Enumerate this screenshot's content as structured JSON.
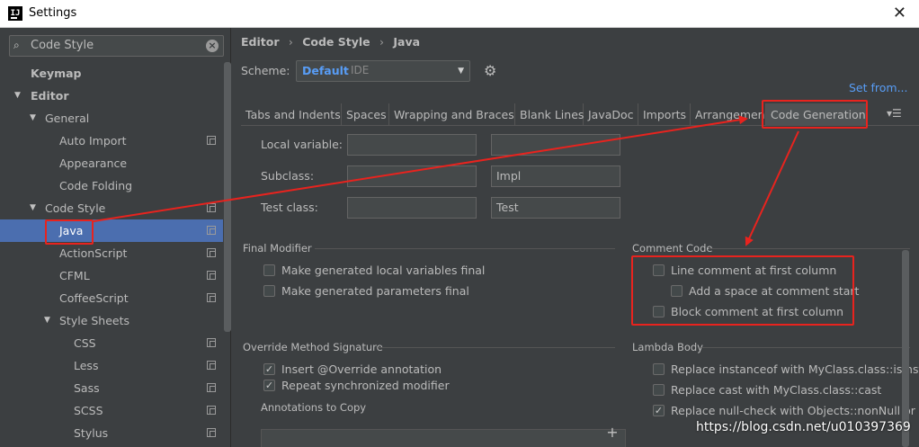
{
  "window": {
    "title": "Settings",
    "app_icon": "IJ"
  },
  "search": {
    "value": "Code Style"
  },
  "sidebar": {
    "items": [
      {
        "label": "Keymap"
      },
      {
        "label": "Editor"
      },
      {
        "label": "General"
      },
      {
        "label": "Auto Import"
      },
      {
        "label": "Appearance"
      },
      {
        "label": "Code Folding"
      },
      {
        "label": "Code Style"
      },
      {
        "label": "Java"
      },
      {
        "label": "ActionScript"
      },
      {
        "label": "CFML"
      },
      {
        "label": "CoffeeScript"
      },
      {
        "label": "Style Sheets"
      },
      {
        "label": "CSS"
      },
      {
        "label": "Less"
      },
      {
        "label": "Sass"
      },
      {
        "label": "SCSS"
      },
      {
        "label": "Stylus"
      }
    ]
  },
  "breadcrumb": {
    "editor": "Editor",
    "code_style": "Code Style",
    "java": "Java",
    "sep": "›"
  },
  "scheme": {
    "label": "Scheme:",
    "value": "Default",
    "scope": "IDE"
  },
  "set_from": "Set from...",
  "tabs": [
    "Tabs and Indents",
    "Spaces",
    "Wrapping and Braces",
    "Blank Lines",
    "JavaDoc",
    "Imports",
    "Arrangement",
    "Code Generation"
  ],
  "naming": {
    "local_variable": {
      "label": "Local variable:",
      "prefix": "",
      "suffix": ""
    },
    "subclass": {
      "label": "Subclass:",
      "prefix": "",
      "suffix": "Impl"
    },
    "test_class": {
      "label": "Test class:",
      "prefix": "",
      "suffix": "Test"
    }
  },
  "final_modifier": {
    "title": "Final Modifier",
    "options": [
      {
        "label": "Make generated local variables final",
        "checked": false
      },
      {
        "label": "Make generated parameters final",
        "checked": false
      }
    ]
  },
  "comment_code": {
    "title": "Comment Code",
    "options": [
      {
        "label": "Line comment at first column",
        "checked": false
      },
      {
        "label": "Add a space at comment start",
        "checked": false
      },
      {
        "label": "Block comment at first column",
        "checked": false
      }
    ]
  },
  "override": {
    "title": "Override Method Signature",
    "options": [
      {
        "label": "Insert @Override annotation",
        "checked": true
      },
      {
        "label": "Repeat synchronized modifier",
        "checked": true
      }
    ],
    "annotations_label": "Annotations to Copy"
  },
  "lambda": {
    "title": "Lambda Body",
    "options": [
      {
        "label": "Replace instanceof with MyClass.class::isInstar",
        "checked": false
      },
      {
        "label": "Replace cast with MyClass.class::cast",
        "checked": false
      },
      {
        "label": "Replace null-check with Objects::nonNull or O",
        "checked": true
      }
    ]
  },
  "watermark": "https://blog.csdn.net/u010397369",
  "icons": {
    "check": "✓",
    "search": "search-icon",
    "clear": "clear-icon",
    "gear": "gear-icon",
    "plus": "+"
  },
  "colors": {
    "accent": "#4b6eaf",
    "link": "#589df6",
    "annotation": "#e8231e",
    "background": "#3c3f41"
  }
}
